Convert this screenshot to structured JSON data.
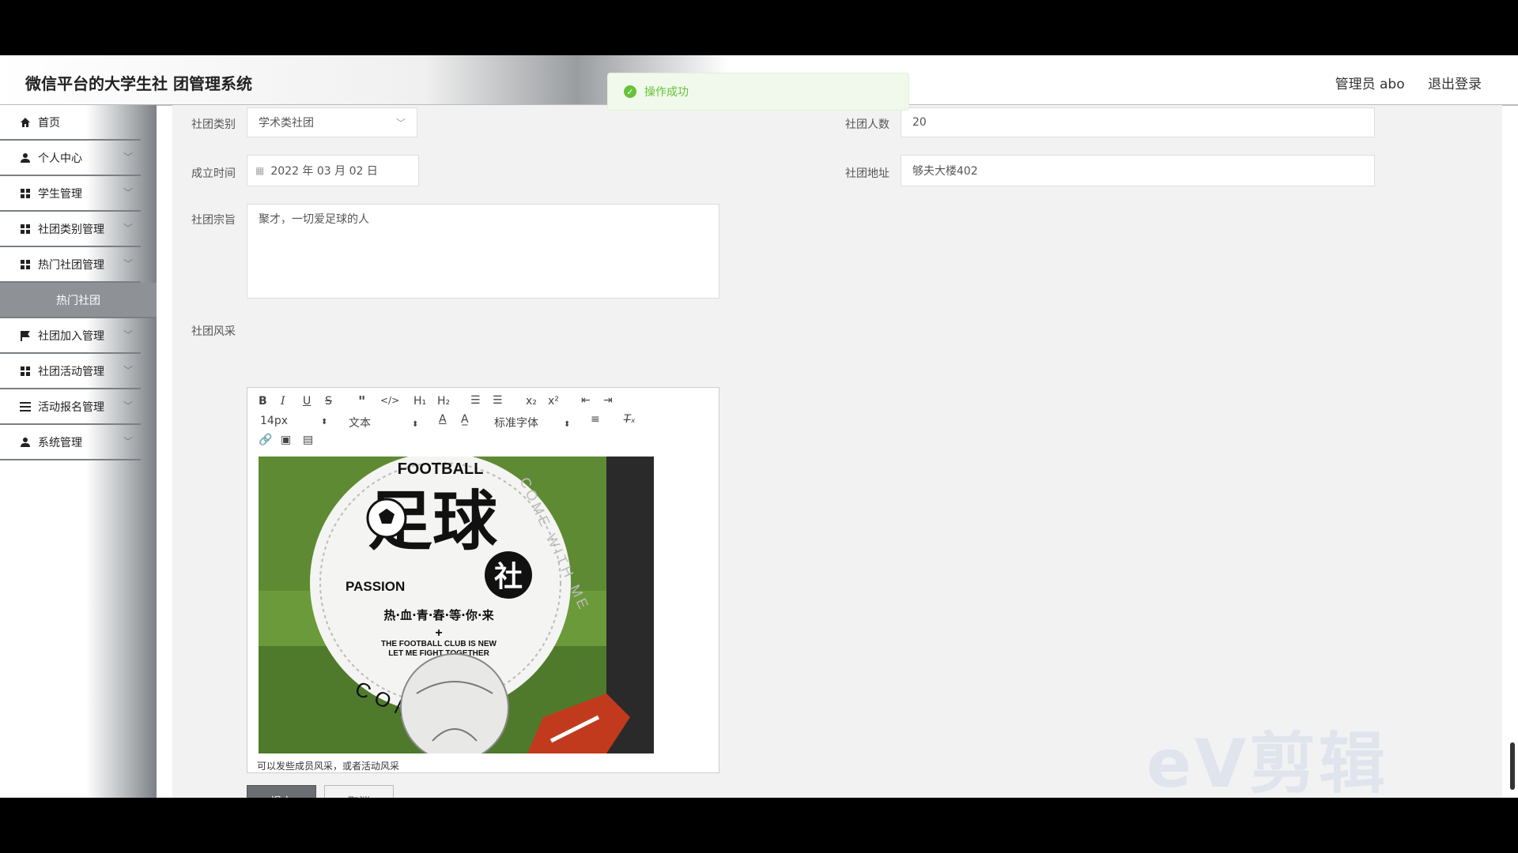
{
  "header": {
    "title": "微信平台的大学生社 团管理系统",
    "user": "管理员 abo",
    "logout": "退出登录"
  },
  "toast": {
    "message": "操作成功"
  },
  "sidebar": {
    "items": [
      {
        "label": "首页",
        "icon": "home-icon"
      },
      {
        "label": "个人中心",
        "icon": "user-icon"
      },
      {
        "label": "学生管理",
        "icon": "grid-icon"
      },
      {
        "label": "社团类别管理",
        "icon": "grid-icon"
      },
      {
        "label": "热门社团管理",
        "icon": "grid-icon"
      },
      {
        "label": "热门社团",
        "icon": ""
      },
      {
        "label": "社团加入管理",
        "icon": "flag-icon"
      },
      {
        "label": "社团活动管理",
        "icon": "grid-icon"
      },
      {
        "label": "活动报名管理",
        "icon": "list-icon"
      },
      {
        "label": "系统管理",
        "icon": "user-icon"
      }
    ]
  },
  "form": {
    "category_label": "社团类别",
    "category_value": "学术类社团",
    "members_label": "社团人数",
    "members_value": "20",
    "founded_label": "成立时间",
    "founded_value": "2022 年 03 月 02 日",
    "address_label": "社团地址",
    "address_value": "够夫大楼402",
    "purpose_label": "社团宗旨",
    "purpose_value": "聚才，一切爱足球的人",
    "style_label": "社团风采",
    "editor_font_size": "14px",
    "editor_block": "文本",
    "editor_font": "标准字体",
    "editor_caption": "可以发些成员风采，或者活动风采",
    "submit": "提交",
    "cancel": "取消"
  },
  "poster": {
    "top": "FOOTBALL",
    "big1": "足球",
    "big2": "社",
    "passion": "PASSION",
    "slogan": "热·血·青·春·等·你·来",
    "plus": "+",
    "line1": "THE FOOTBALL CLUB IS NEW",
    "line2": "LET ME FIGHT TOGETHER",
    "ring1": "COME WITH ME",
    "ring2": "COME"
  },
  "watermark": "eV剪辑",
  "colors": {
    "accent": "#67c23a",
    "sidebar_dark": "#7c8084",
    "submit_bg": "#6b6e72"
  }
}
